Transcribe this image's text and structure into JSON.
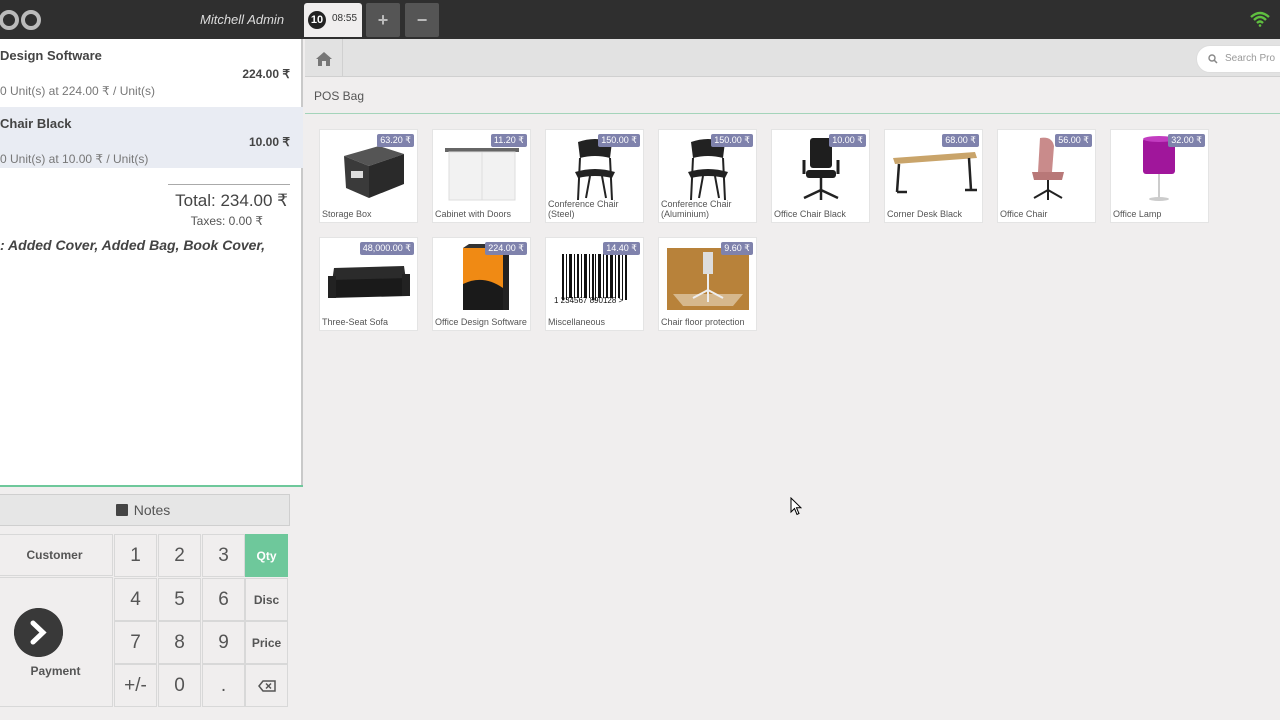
{
  "topbar": {
    "user_name": "Mitchell Admin",
    "order_number": "10",
    "order_time": "08:55",
    "add_label": "+",
    "remove_label": "−"
  },
  "orderlines": [
    {
      "name": "Design Software",
      "price": "224.00 ₹",
      "info": "0 Unit(s) at 224.00 ₹ / Unit(s)"
    },
    {
      "name": "Chair Black",
      "price": "10.00 ₹",
      "info": "0 Unit(s) at 10.00 ₹ / Unit(s)"
    }
  ],
  "summary": {
    "total_label": "Total: 234.00 ₹",
    "taxes_label": "Taxes: 0.00 ₹",
    "note": ": Added Cover, Added Bag, Book Cover,"
  },
  "controls": {
    "notes": "Notes",
    "customer": "Customer",
    "payment": "Payment",
    "keys": [
      "1",
      "2",
      "3",
      "Qty",
      "4",
      "5",
      "6",
      "Disc",
      "7",
      "8",
      "9",
      "Price",
      "+/-",
      "0",
      "."
    ]
  },
  "search": {
    "placeholder": "Search Pro"
  },
  "category": "POS Bag",
  "products": [
    {
      "name": "Storage Box",
      "price": "63.20 ₹",
      "icon": "storage-box"
    },
    {
      "name": "Cabinet with Doors",
      "price": "11.20 ₹",
      "icon": "cabinet"
    },
    {
      "name": "Conference Chair (Steel)",
      "price": "150.00 ₹",
      "icon": "conference-chair"
    },
    {
      "name": "Conference Chair (Aluminium)",
      "price": "150.00 ₹",
      "icon": "conference-chair"
    },
    {
      "name": "Office Chair Black",
      "price": "10.00 ₹",
      "icon": "office-chair-black"
    },
    {
      "name": "Corner Desk Black",
      "price": "68.00 ₹",
      "icon": "desk"
    },
    {
      "name": "Office Chair",
      "price": "56.00 ₹",
      "icon": "pink-chair"
    },
    {
      "name": "Office Lamp",
      "price": "32.00 ₹",
      "icon": "lamp"
    },
    {
      "name": "Three-Seat Sofa",
      "price": "48,000.00 ₹",
      "icon": "sofa"
    },
    {
      "name": "Office Design Software",
      "price": "224.00 ₹",
      "icon": "software-box"
    },
    {
      "name": "Miscellaneous",
      "price": "14.40 ₹",
      "icon": "barcode"
    },
    {
      "name": "Chair floor protection",
      "price": "9.60 ₹",
      "icon": "floor-mat"
    }
  ],
  "barcode_text": "1 234567 890128 >",
  "colors": {
    "accent": "#6ec89b",
    "price_badge": "#7f82ac",
    "topbar": "#2f2f2f"
  }
}
